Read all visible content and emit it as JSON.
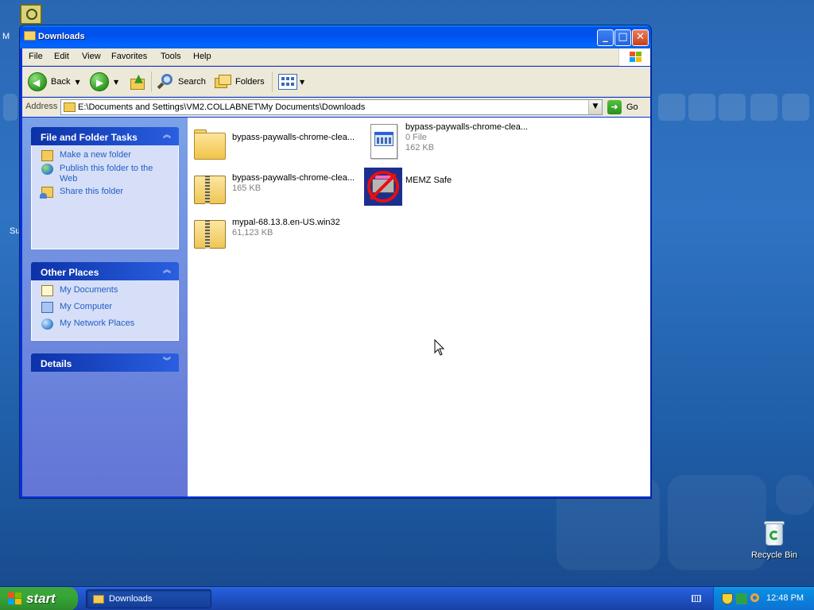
{
  "desktop": {
    "fragments": [
      "M",
      "Su"
    ],
    "recycle_bin_label": "Recycle Bin"
  },
  "window": {
    "title": "Downloads",
    "controls": {
      "minimize": "_",
      "maximize": "□",
      "close": "✕"
    }
  },
  "menu": [
    "File",
    "Edit",
    "View",
    "Favorites",
    "Tools",
    "Help"
  ],
  "toolbar": {
    "back_label": "Back",
    "search_label": "Search",
    "folders_label": "Folders"
  },
  "address": {
    "label": "Address",
    "value": "E:\\Documents and Settings\\VM2.COLLABNET\\My Documents\\Downloads",
    "go_label": "Go"
  },
  "taskpane": {
    "file_tasks": {
      "title": "File and Folder Tasks",
      "items": [
        "Make a new folder",
        "Publish this folder to the Web",
        "Share this folder"
      ]
    },
    "other_places": {
      "title": "Other Places",
      "items": [
        "My Documents",
        "My Computer",
        "My Network Places"
      ]
    },
    "details": {
      "title": "Details"
    }
  },
  "files": [
    {
      "name": "bypass-paywalls-chrome-clea...",
      "kind": "folder",
      "meta1": "",
      "meta2": ""
    },
    {
      "name": "bypass-paywalls-chrome-clea...",
      "kind": "exe",
      "meta1": "0 File",
      "meta2": "162 KB"
    },
    {
      "name": "bypass-paywalls-chrome-clea...",
      "kind": "zip",
      "meta1": "165 KB",
      "meta2": ""
    },
    {
      "name": "MEMZ Safe",
      "kind": "memz",
      "meta1": "",
      "meta2": ""
    },
    {
      "name": "mypal-68.13.8.en-US.win32",
      "kind": "zip",
      "meta1": "61,123 KB",
      "meta2": ""
    }
  ],
  "taskbar": {
    "start_label": "start",
    "task_button": "Downloads",
    "clock": "12:48 PM"
  },
  "colors": {
    "title_blue": "#0053ee",
    "task_link": "#215dc6",
    "start_green": "#36a636",
    "tray_blue": "#0d71d2"
  }
}
